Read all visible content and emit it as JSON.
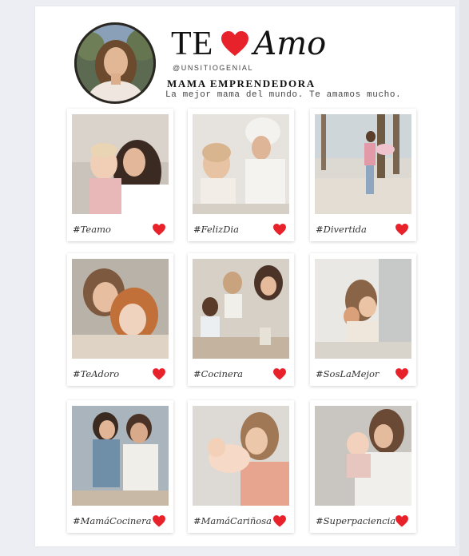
{
  "header": {
    "title_te": "TE",
    "title_amo": "Amo",
    "handle": "@UNSITIOGENIAL",
    "role": "MAMA EMPRENDEDORA",
    "tagline": "La mejor mama del mundo. Te amamos mucho."
  },
  "colors": {
    "heart": "#e8222b",
    "page_bg": "#eceef3",
    "canvas_bg": "#ffffff"
  },
  "cards": [
    {
      "caption": "#Teamo",
      "photo": "mother kissing baby"
    },
    {
      "caption": "#FelizDia",
      "photo": "spa mother and daughter"
    },
    {
      "caption": "#Divertida",
      "photo": "mother spinning child outdoors"
    },
    {
      "caption": "#TeAdoro",
      "photo": "mother hugging redhead girl"
    },
    {
      "caption": "#Cocinera",
      "photo": "family baking"
    },
    {
      "caption": "#SosLaMejor",
      "photo": "mother and daughter at home"
    },
    {
      "caption": "#MamáCocinera",
      "photo": "grandmother and mother cooking"
    },
    {
      "caption": "#MamáCariñosa",
      "photo": "mother kissing newborn"
    },
    {
      "caption": "#Superpaciencia",
      "photo": "mother holding baby"
    }
  ]
}
